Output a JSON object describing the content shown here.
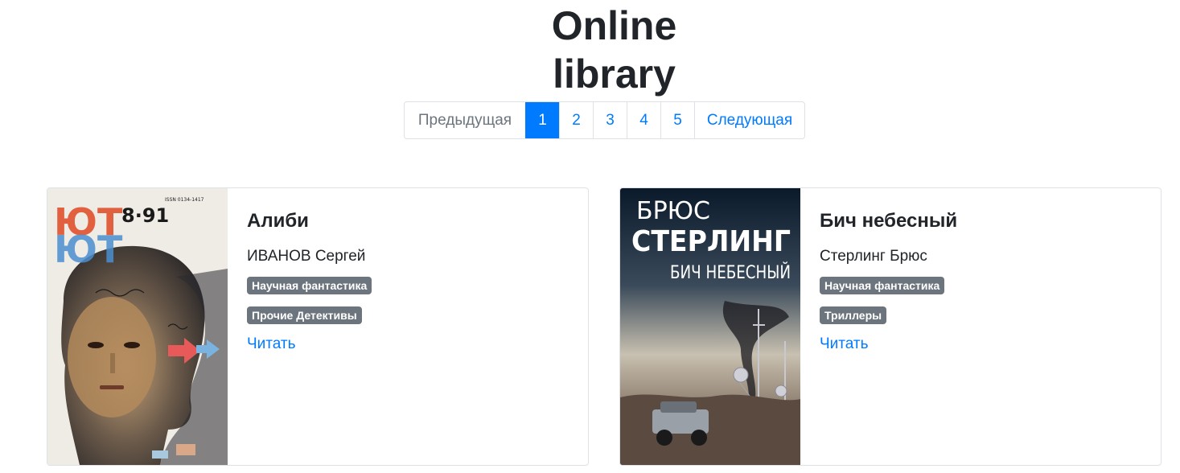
{
  "header": {
    "title_line1": "Online",
    "title_line2": "library"
  },
  "pagination": {
    "prev_label": "Предыдущая",
    "pages": [
      "1",
      "2",
      "3",
      "4",
      "5"
    ],
    "active_page": "1",
    "next_label": "Следующая"
  },
  "books": [
    {
      "title": "Алиби",
      "author": "ИВАНОВ Сергей",
      "genres": [
        "Научная фантастика",
        "Прочие Детективы"
      ],
      "read_label": "Читать",
      "cover": {
        "logo_text": "ЮТ",
        "issue_text": "8·91",
        "issn_text": "ISSN 0134-1417"
      }
    },
    {
      "title": "Бич небесный",
      "author": "Стерлинг Брюс",
      "genres": [
        "Научная фантастика",
        "Триллеры"
      ],
      "read_label": "Читать",
      "cover": {
        "author_first": "БРЮС",
        "author_last": "СТЕРЛИНГ",
        "title_text": "БИЧ НЕБЕСНЫЙ"
      }
    }
  ],
  "colors": {
    "primary": "#007bff",
    "badge": "#6c757d",
    "border": "#dee2e6"
  }
}
